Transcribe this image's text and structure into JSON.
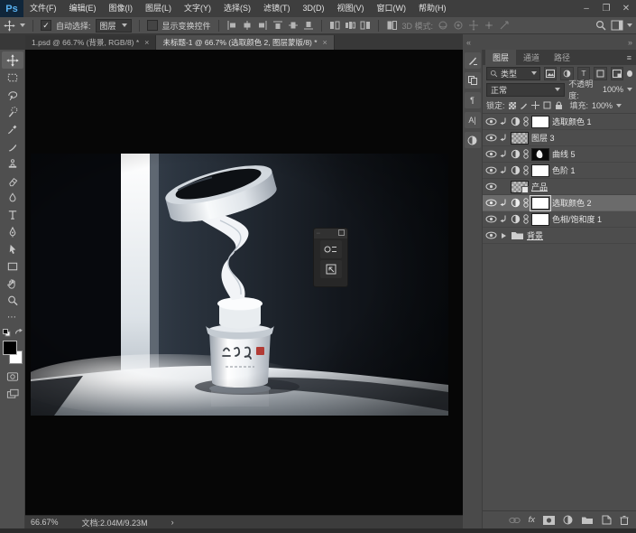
{
  "window": {
    "minimize": "–",
    "maximize": "❐",
    "close": "✕"
  },
  "menubar": {
    "logo": "Ps",
    "items": [
      "文件(F)",
      "编辑(E)",
      "图像(I)",
      "图层(L)",
      "文字(Y)",
      "选择(S)",
      "滤镜(T)",
      "3D(D)",
      "视图(V)",
      "窗口(W)",
      "帮助(H)"
    ]
  },
  "optionsbar": {
    "auto_select_label": "自动选择:",
    "auto_select_value": "图层",
    "auto_select_checked": "✓",
    "show_transform_label": "显示变换控件",
    "mode_label": "3D 模式:"
  },
  "tabs": {
    "tab1": "1.psd @ 66.7% (背景, RGB/8) *",
    "tab2": "未标题-1 @ 66.7% (选取颜色 2, 图层蒙版/8) *",
    "close": "×"
  },
  "panel_strip": {
    "collapse_left": "«",
    "collapse_right": "»"
  },
  "layers_panel": {
    "tabs": {
      "layers": "图层",
      "channels": "通道",
      "paths": "路径"
    },
    "panel_menu": "≡",
    "filter_value": "类型",
    "filter_type_label": "T",
    "blend_mode": "正常",
    "opacity_label": "不透明度:",
    "opacity_value": "100%",
    "lock_label": "锁定:",
    "fill_label": "填充:",
    "fill_value": "100%",
    "rows": [
      {
        "name": "选取颜色 1"
      },
      {
        "name": "图层 3"
      },
      {
        "name": "曲线 5"
      },
      {
        "name": "色阶 1"
      },
      {
        "name": "产品"
      },
      {
        "name": "选取颜色 2"
      },
      {
        "name": "色相/饱和度 1"
      },
      {
        "name": "背景"
      }
    ],
    "fx_label": "fx"
  },
  "statusbar": {
    "zoom_value": "66.67%",
    "doc_info": "文档:2.04M/9.23M",
    "arrow": "›"
  },
  "colors": {
    "app_bg": "#4f4f4f",
    "menubar_bg": "#3e3e3e",
    "ps_logo_blue": "#59b2f2",
    "ps_logo_bg": "#10263a",
    "control_bg": "#3a3a3a",
    "selected_layer_row": "#6b6b6b",
    "canvas_black": "#060606",
    "seal_red": "#b23b35"
  }
}
